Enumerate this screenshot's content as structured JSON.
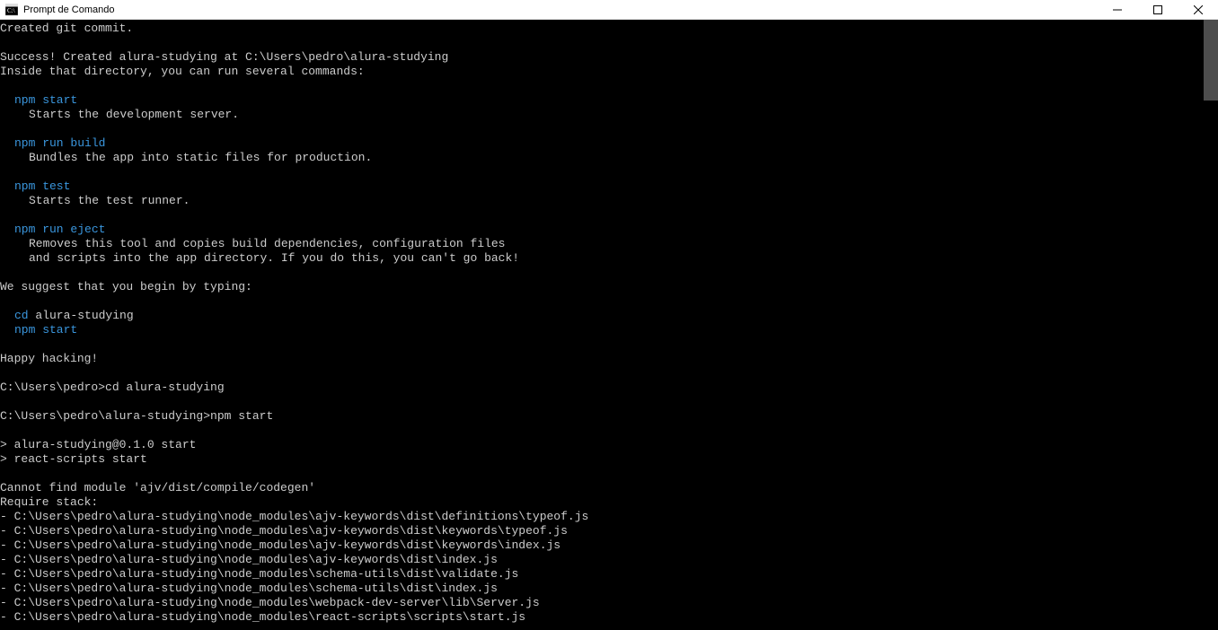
{
  "window": {
    "title": "Prompt de Comando"
  },
  "terminal": {
    "lines": [
      {
        "segments": [
          {
            "text": "Created git commit.",
            "color": "white"
          }
        ]
      },
      {
        "segments": []
      },
      {
        "segments": [
          {
            "text": "Success! Created alura-studying at C:\\Users\\pedro\\alura-studying",
            "color": "white"
          }
        ]
      },
      {
        "segments": [
          {
            "text": "Inside that directory, you can run several commands:",
            "color": "white"
          }
        ]
      },
      {
        "segments": []
      },
      {
        "indent": 1,
        "segments": [
          {
            "text": "npm start",
            "color": "cyan"
          }
        ]
      },
      {
        "indent": 2,
        "segments": [
          {
            "text": "Starts the development server.",
            "color": "white"
          }
        ]
      },
      {
        "segments": []
      },
      {
        "indent": 1,
        "segments": [
          {
            "text": "npm run build",
            "color": "cyan"
          }
        ]
      },
      {
        "indent": 2,
        "segments": [
          {
            "text": "Bundles the app into static files for production.",
            "color": "white"
          }
        ]
      },
      {
        "segments": []
      },
      {
        "indent": 1,
        "segments": [
          {
            "text": "npm test",
            "color": "cyan"
          }
        ]
      },
      {
        "indent": 2,
        "segments": [
          {
            "text": "Starts the test runner.",
            "color": "white"
          }
        ]
      },
      {
        "segments": []
      },
      {
        "indent": 1,
        "segments": [
          {
            "text": "npm run eject",
            "color": "cyan"
          }
        ]
      },
      {
        "indent": 2,
        "segments": [
          {
            "text": "Removes this tool and copies build dependencies, configuration files",
            "color": "white"
          }
        ]
      },
      {
        "indent": 2,
        "segments": [
          {
            "text": "and scripts into the app directory. If you do this, you can't go back!",
            "color": "white"
          }
        ]
      },
      {
        "segments": []
      },
      {
        "segments": [
          {
            "text": "We suggest that you begin by typing:",
            "color": "white"
          }
        ]
      },
      {
        "segments": []
      },
      {
        "indent": 1,
        "segments": [
          {
            "text": "cd ",
            "color": "cyan"
          },
          {
            "text": "alura-studying",
            "color": "white"
          }
        ]
      },
      {
        "indent": 1,
        "segments": [
          {
            "text": "npm start",
            "color": "cyan"
          }
        ]
      },
      {
        "segments": []
      },
      {
        "segments": [
          {
            "text": "Happy hacking!",
            "color": "white"
          }
        ]
      },
      {
        "segments": []
      },
      {
        "segments": [
          {
            "text": "C:\\Users\\pedro>cd alura-studying",
            "color": "white"
          }
        ]
      },
      {
        "segments": []
      },
      {
        "segments": [
          {
            "text": "C:\\Users\\pedro\\alura-studying>npm start",
            "color": "white"
          }
        ]
      },
      {
        "segments": []
      },
      {
        "segments": [
          {
            "text": "> alura-studying@0.1.0 start",
            "color": "white"
          }
        ]
      },
      {
        "segments": [
          {
            "text": "> react-scripts start",
            "color": "white"
          }
        ]
      },
      {
        "segments": []
      },
      {
        "segments": [
          {
            "text": "Cannot find module 'ajv/dist/compile/codegen'",
            "color": "white"
          }
        ]
      },
      {
        "segments": [
          {
            "text": "Require stack:",
            "color": "white"
          }
        ]
      },
      {
        "segments": [
          {
            "text": "- C:\\Users\\pedro\\alura-studying\\node_modules\\ajv-keywords\\dist\\definitions\\typeof.js",
            "color": "white"
          }
        ]
      },
      {
        "segments": [
          {
            "text": "- C:\\Users\\pedro\\alura-studying\\node_modules\\ajv-keywords\\dist\\keywords\\typeof.js",
            "color": "white"
          }
        ]
      },
      {
        "segments": [
          {
            "text": "- C:\\Users\\pedro\\alura-studying\\node_modules\\ajv-keywords\\dist\\keywords\\index.js",
            "color": "white"
          }
        ]
      },
      {
        "segments": [
          {
            "text": "- C:\\Users\\pedro\\alura-studying\\node_modules\\ajv-keywords\\dist\\index.js",
            "color": "white"
          }
        ]
      },
      {
        "segments": [
          {
            "text": "- C:\\Users\\pedro\\alura-studying\\node_modules\\schema-utils\\dist\\validate.js",
            "color": "white"
          }
        ]
      },
      {
        "segments": [
          {
            "text": "- C:\\Users\\pedro\\alura-studying\\node_modules\\schema-utils\\dist\\index.js",
            "color": "white"
          }
        ]
      },
      {
        "segments": [
          {
            "text": "- C:\\Users\\pedro\\alura-studying\\node_modules\\webpack-dev-server\\lib\\Server.js",
            "color": "white"
          }
        ]
      },
      {
        "segments": [
          {
            "text": "- C:\\Users\\pedro\\alura-studying\\node_modules\\react-scripts\\scripts\\start.js",
            "color": "white"
          }
        ]
      }
    ]
  }
}
